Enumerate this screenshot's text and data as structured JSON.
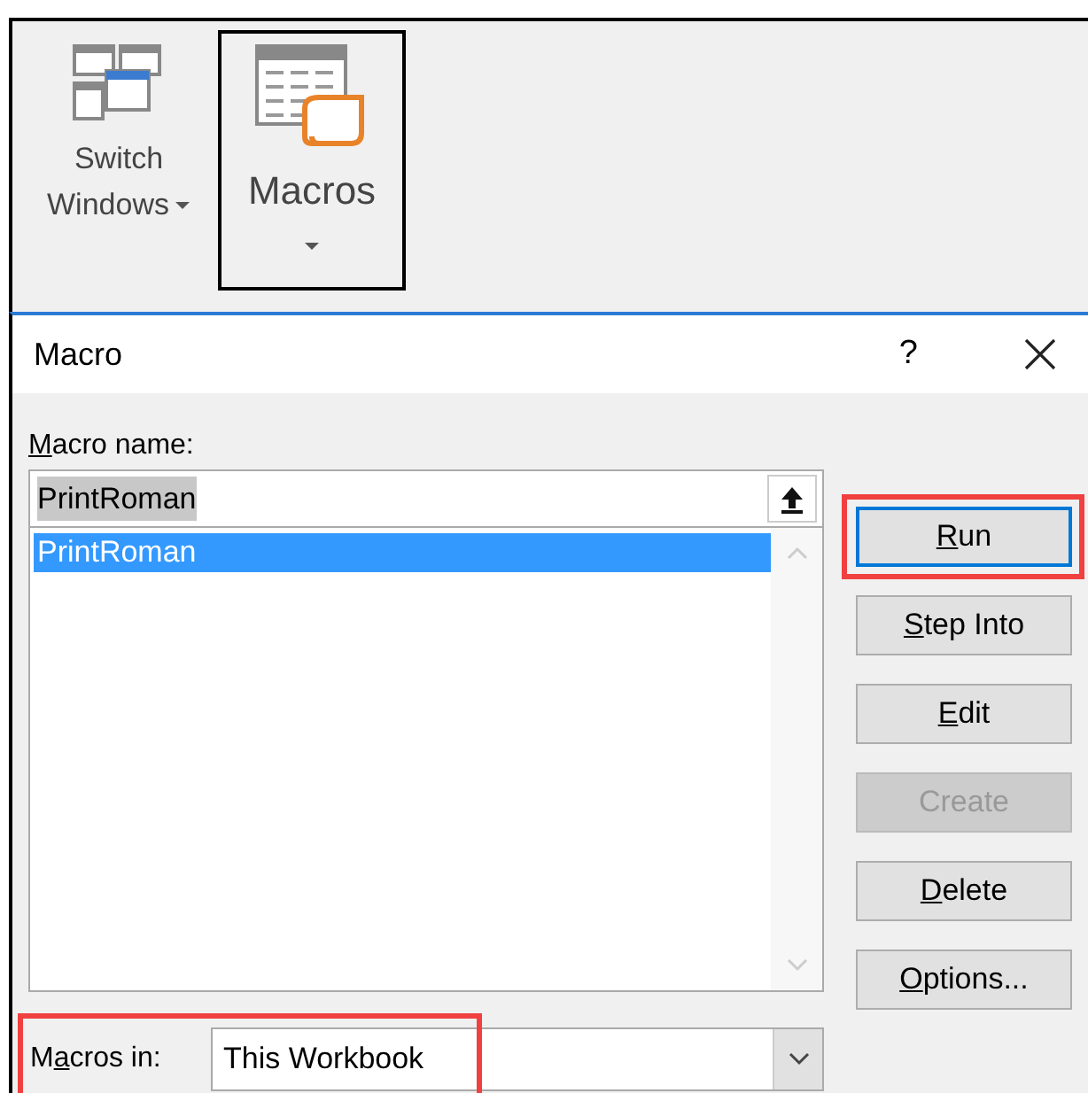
{
  "ribbon": {
    "buttons": [
      {
        "kind": "windows",
        "label_lines": [
          "Switch",
          "Windows"
        ],
        "selected": false,
        "dropdown": true
      },
      {
        "kind": "macros",
        "label_lines": [
          "Macros"
        ],
        "selected": true,
        "dropdown": true
      }
    ]
  },
  "dialog": {
    "title": "Macro",
    "help": "?",
    "macro_name": {
      "label": {
        "key": "M",
        "after": "acro name:"
      },
      "value": "PrintRoman"
    },
    "macro_list": [
      {
        "name": "PrintRoman",
        "selected": true
      }
    ],
    "macros_in": {
      "label": {
        "before": "M",
        "key": "a",
        "after": "cros in:"
      },
      "value": "This Workbook",
      "highlighted": true
    },
    "buttons": [
      {
        "label": {
          "key": "R",
          "after": "un"
        },
        "disabled": false,
        "default": true,
        "highlighted": true
      },
      {
        "label": {
          "key": "S",
          "after": "tep Into"
        },
        "disabled": false,
        "default": false,
        "highlighted": false
      },
      {
        "label": {
          "key": "E",
          "after": "dit"
        },
        "disabled": false,
        "default": false,
        "highlighted": false
      },
      {
        "label": {
          "before": "Create"
        },
        "disabled": true,
        "default": false,
        "highlighted": false
      },
      {
        "label": {
          "key": "D",
          "after": "elete"
        },
        "disabled": false,
        "default": false,
        "highlighted": false
      },
      {
        "label": {
          "key": "O",
          "after": "ptions..."
        },
        "disabled": false,
        "default": false,
        "highlighted": false
      }
    ]
  }
}
